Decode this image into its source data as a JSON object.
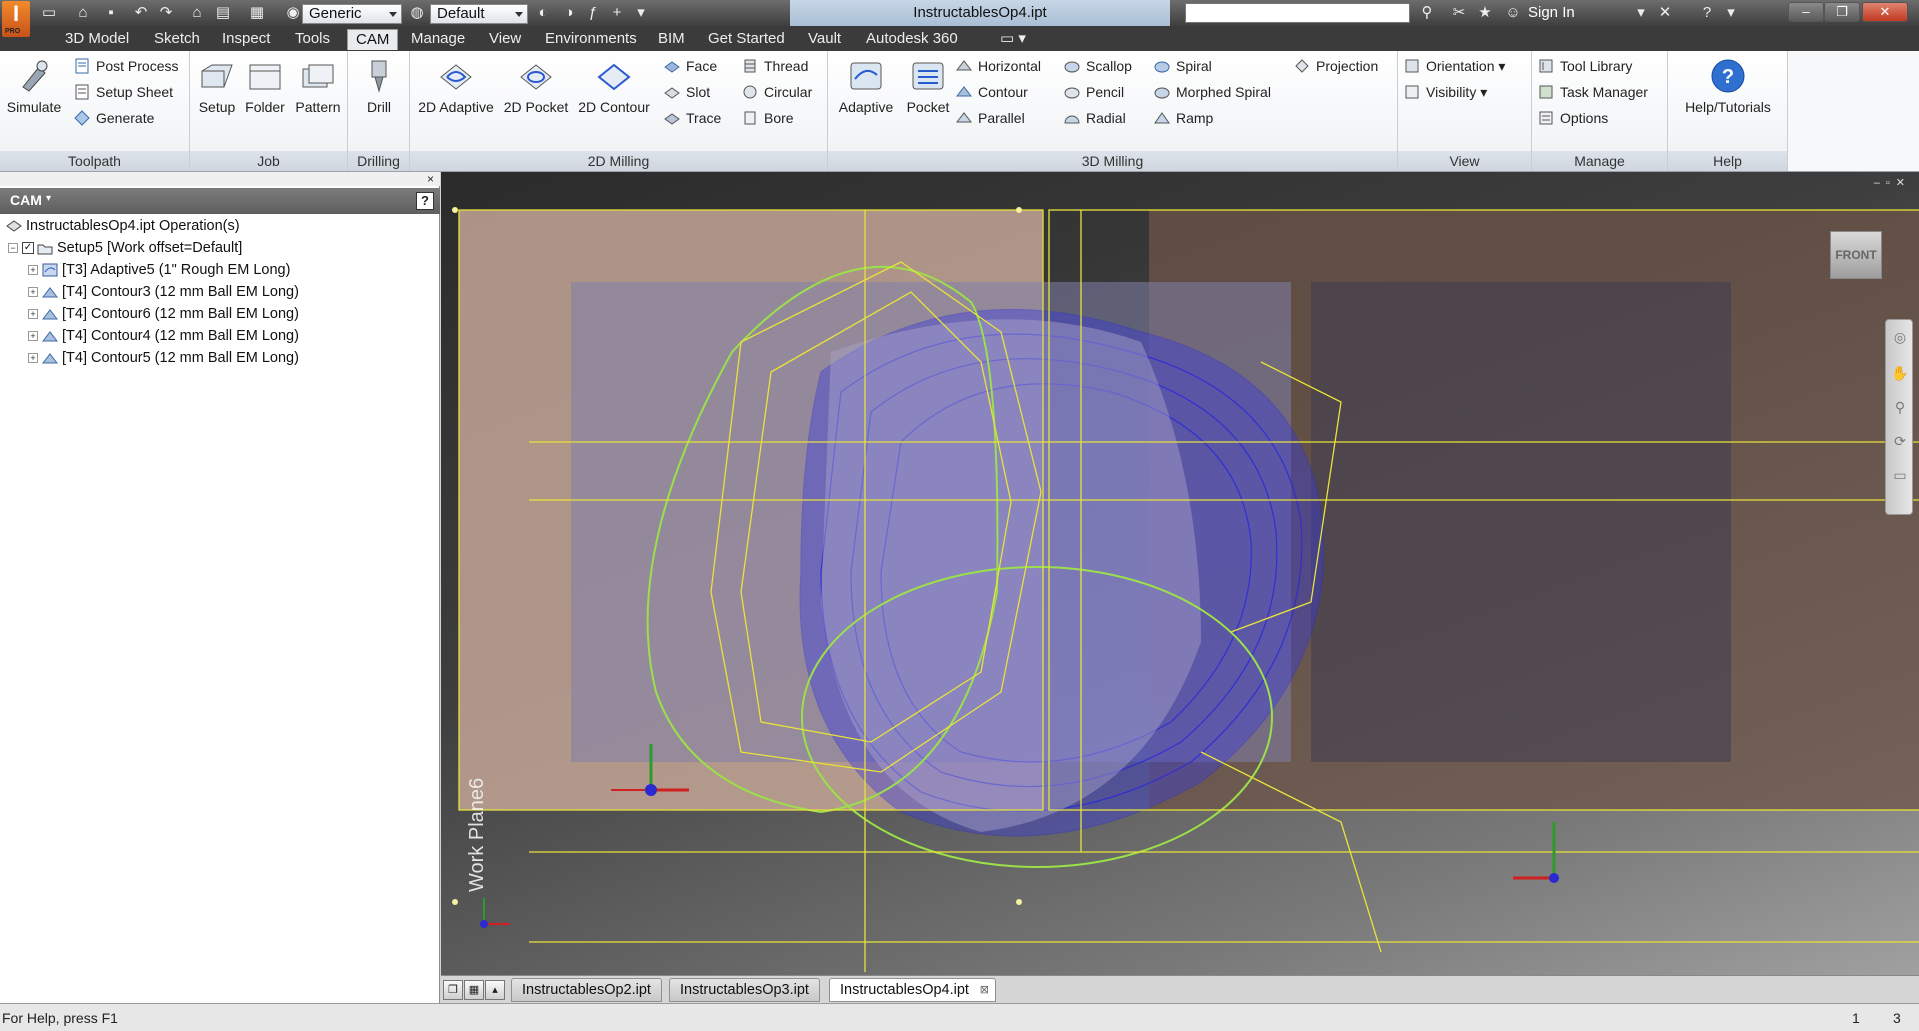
{
  "titlebar": {
    "app_letter": "I",
    "app_badge": "PRO",
    "material_value": "Generic",
    "appearance_value": "Default",
    "document_title": "InstructablesOp4.ipt",
    "search_placeholder": "",
    "sign_in": "Sign In",
    "help_symbol": "?"
  },
  "menu": {
    "tabs": [
      "3D Model",
      "Sketch",
      "Inspect",
      "Tools",
      "CAM",
      "Manage",
      "View",
      "Environments",
      "BIM",
      "Get Started",
      "Vault",
      "Autodesk 360"
    ],
    "active": "CAM"
  },
  "ribbon": {
    "toolpath": {
      "title": "Toolpath",
      "simulate": "Simulate",
      "post_process": "Post Process",
      "setup_sheet": "Setup Sheet",
      "generate": "Generate"
    },
    "job": {
      "title": "Job",
      "setup": "Setup",
      "folder": "Folder",
      "pattern": "Pattern"
    },
    "drilling": {
      "title": "Drilling",
      "drill": "Drill"
    },
    "milling2d": {
      "title": "2D Milling",
      "adaptive": "2D Adaptive",
      "pocket": "2D Pocket",
      "contour": "2D Contour",
      "face": "Face",
      "slot": "Slot",
      "trace": "Trace",
      "thread": "Thread",
      "circular": "Circular",
      "bore": "Bore"
    },
    "milling3d": {
      "title": "3D Milling",
      "adaptive": "Adaptive",
      "pocket": "Pocket",
      "horizontal": "Horizontal",
      "contour": "Contour",
      "parallel": "Parallel",
      "scallop": "Scallop",
      "pencil": "Pencil",
      "radial": "Radial",
      "spiral": "Spiral",
      "morphed_spiral": "Morphed Spiral",
      "ramp": "Ramp",
      "projection": "Projection"
    },
    "view": {
      "title": "View",
      "orientation": "Orientation",
      "visibility": "Visibility"
    },
    "manage": {
      "title": "Manage",
      "tool_library": "Tool Library",
      "task_manager": "Task Manager",
      "options": "Options"
    },
    "help": {
      "title": "Help",
      "help_tutorials": "Help/Tutorials"
    }
  },
  "browser": {
    "header": "CAM",
    "help_symbol": "?",
    "close_symbol": "×",
    "root": "InstructablesOp4.ipt Operation(s)",
    "setup": "Setup5 [Work offset=Default]",
    "operations": [
      "[T3] Adaptive5 (1\" Rough EM Long)",
      "[T4] Contour3 (12 mm Ball EM Long)",
      "[T4] Contour6 (12 mm Ball EM Long)",
      "[T4] Contour4 (12 mm Ball EM Long)",
      "[T4] Contour5 (12 mm Ball EM Long)"
    ]
  },
  "viewport": {
    "viewcube_face": "FRONT",
    "workplane_label": "Work Plane6"
  },
  "doc_tabs": {
    "tabs": [
      "InstructablesOp2.ipt",
      "InstructablesOp3.ipt",
      "InstructablesOp4.ipt"
    ],
    "active": "InstructablesOp4.ipt"
  },
  "status": {
    "help_text": "For Help, press F1",
    "count_a": "1",
    "count_b": "3"
  },
  "colors": {
    "toolpath_blue": "#2a2adc",
    "toolpath_green": "#9be04a",
    "toolpath_yellow": "#e8e23c",
    "stock_tan": "#c8a896"
  }
}
